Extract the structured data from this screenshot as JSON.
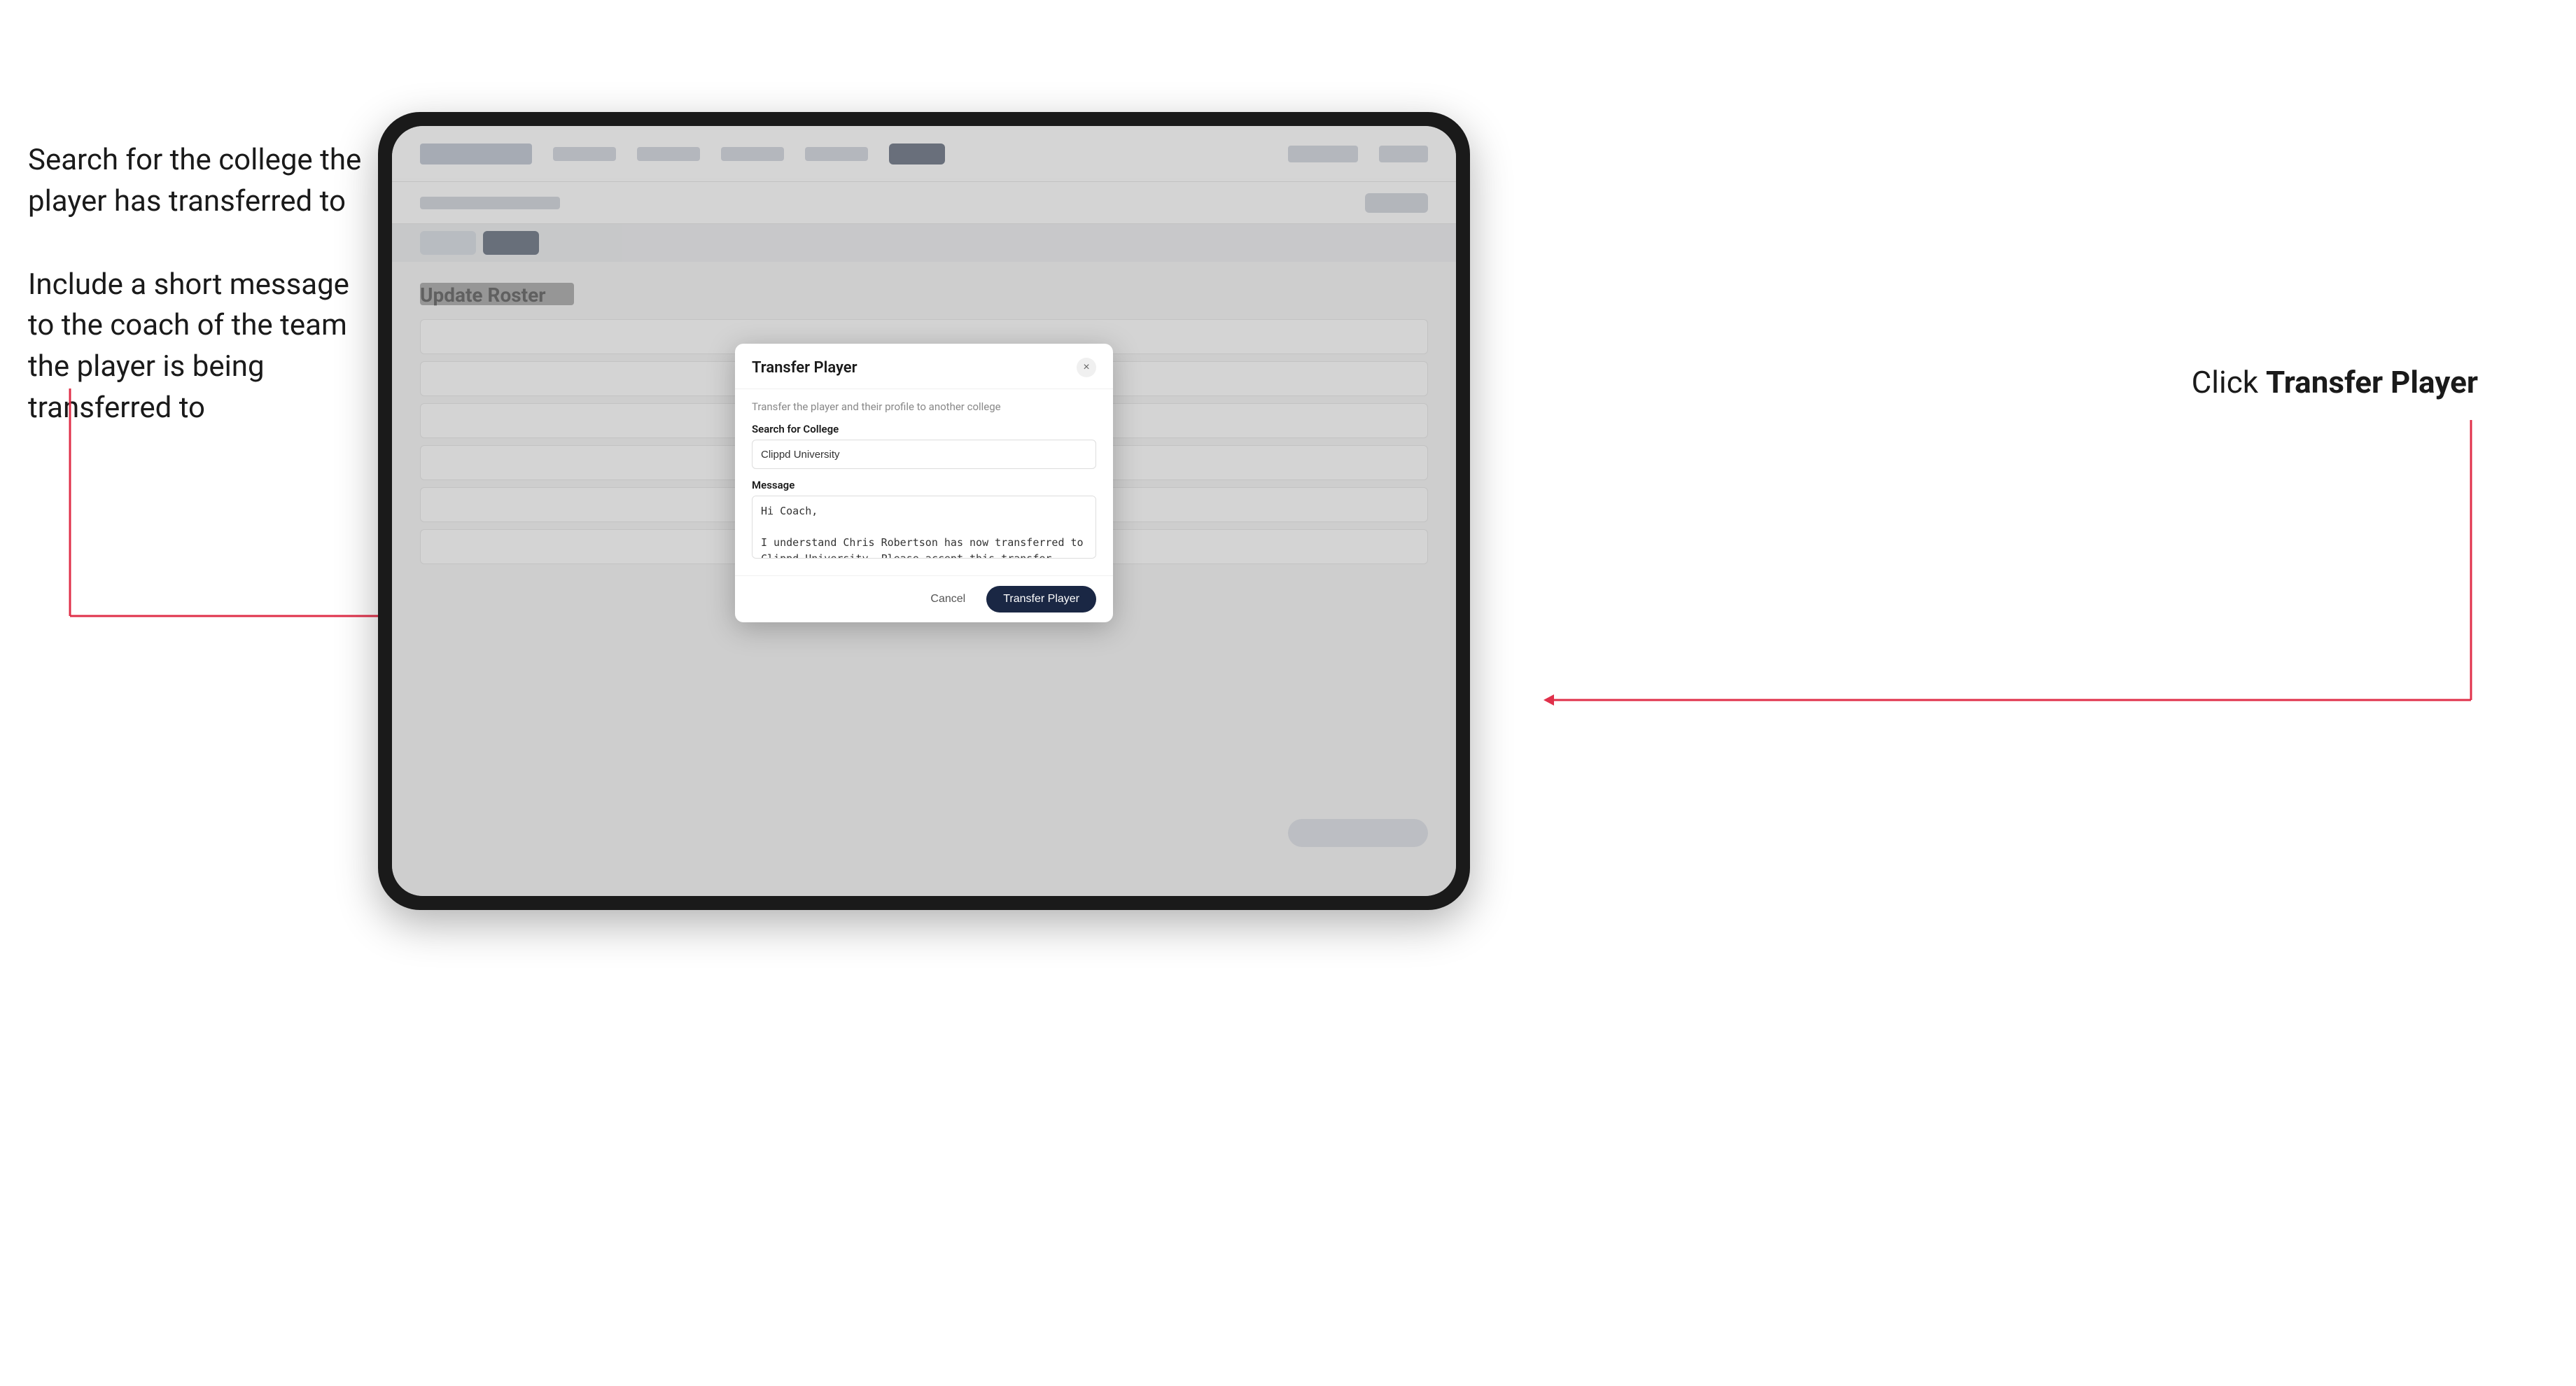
{
  "annotations": {
    "left_top": "Search for the college the player has transferred to",
    "left_bottom": "Include a short message to the coach of the team the player is being transferred to",
    "right": "Click",
    "right_bold": "Transfer Player"
  },
  "modal": {
    "title": "Transfer Player",
    "close_icon": "×",
    "description": "Transfer the player and their profile to another college",
    "college_label": "Search for College",
    "college_value": "Clippd University",
    "message_label": "Message",
    "message_value": "Hi Coach,\n\nI understand Chris Robertson has now transferred to Clippd University. Please accept this transfer request when you can.",
    "cancel_label": "Cancel",
    "transfer_label": "Transfer Player"
  },
  "app": {
    "update_roster": "Update Roster"
  }
}
